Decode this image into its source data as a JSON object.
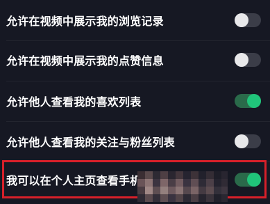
{
  "settings": {
    "items": [
      {
        "label": "允许在视频中展示我的浏览记录",
        "enabled": false
      },
      {
        "label": "允许在视频中展示我的点赞信息",
        "enabled": false
      },
      {
        "label": "允许他人查看我的喜欢列表",
        "enabled": true
      },
      {
        "label": "允许他人查看我的关注与粉丝列表",
        "enabled": false
      },
      {
        "label": "我可以在个人主页查看手机相",
        "enabled": true
      }
    ]
  },
  "colors": {
    "background": "#161823",
    "toggle_on": "#20c47a",
    "toggle_off_knob": "#e8e8ea",
    "highlight": "#d8202a"
  }
}
